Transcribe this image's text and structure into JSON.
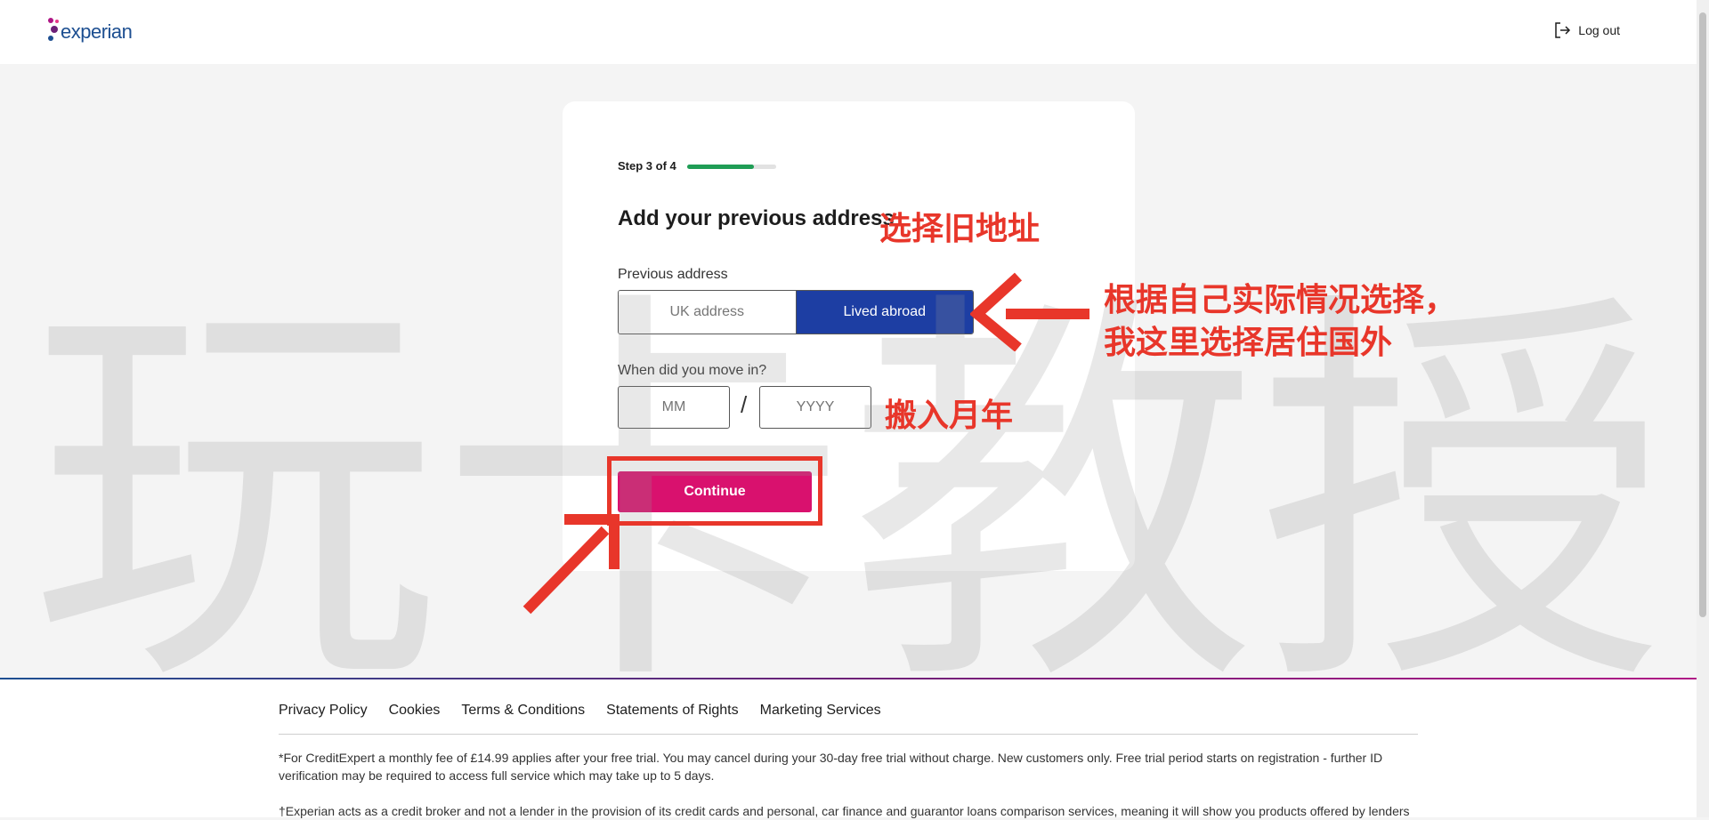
{
  "header": {
    "logo_text": "experian",
    "logout_label": "Log out"
  },
  "card": {
    "step_label": "Step 3 of 4",
    "progress": 0.75,
    "title": "Add your previous address",
    "previous_address_label": "Previous address",
    "options": [
      "UK address",
      "Lived abroad"
    ],
    "selected_option": "Lived abroad",
    "move_in_label": "When did you move in?",
    "month_placeholder": "MM",
    "year_placeholder": "YYYY",
    "date_separator": "/",
    "continue_label": "Continue"
  },
  "footer": {
    "links": [
      "Privacy Policy",
      "Cookies",
      "Terms & Conditions",
      "Statements of Rights",
      "Marketing Services"
    ],
    "note1": "*For CreditExpert a monthly fee of £14.99 applies after your free trial. You may cancel during your 30-day free trial without charge. New customers only. Free trial period starts on registration - further ID verification may be required to access full service which may take up to 5 days.",
    "note2": "†Experian acts as a credit broker and not a lender in the provision of its credit cards and personal, car finance and guarantor loans comparison services, meaning it will show you products offered by lenders"
  },
  "annotations": {
    "title_note": "选择旧地址",
    "option_note_line1": "根据自己实际情况选择，",
    "option_note_line2": "我这里选择居住国外",
    "date_note": "搬入月年",
    "watermark": "玩卡教授"
  },
  "colors": {
    "accent": "#d9116e",
    "selected": "#1d3ea3",
    "progress": "#1f9d55",
    "annotation": "#e8362a"
  }
}
